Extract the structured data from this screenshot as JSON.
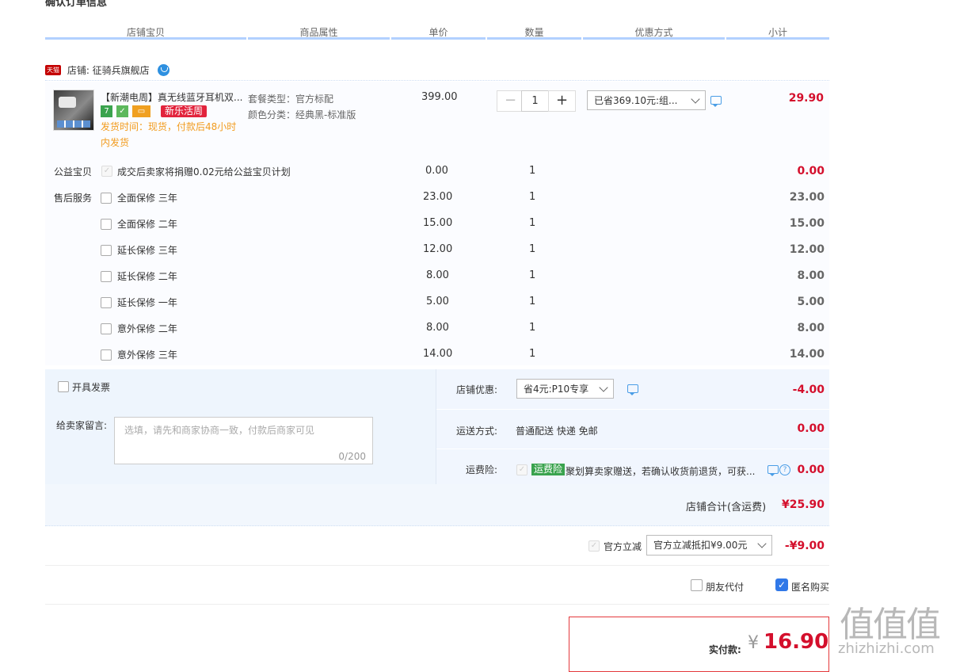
{
  "page_title": "确认订单信息",
  "columns": [
    "店铺宝贝",
    "商品属性",
    "单价",
    "数量",
    "优惠方式",
    "小计"
  ],
  "shop": {
    "badge": "天猫",
    "label": "店铺: 征骑兵旗舰店"
  },
  "item": {
    "title": "【新潮电周】真无线蓝牙耳机双...",
    "icon_7": "7",
    "promo_tag": "新乐活周",
    "delivery": "发货时间：现货，付款后48小时内发货",
    "attr_package": "套餐类型：官方标配",
    "attr_color": "颜色分类：经典黑-标准版",
    "price": "399.00",
    "quantity": "1",
    "minus": "−",
    "plus": "+",
    "discount_select": "已省369.10元:组...",
    "subtotal": "29.90"
  },
  "charity": {
    "label": "公益宝贝",
    "text": "成交后卖家将捐赠0.02元给公益宝贝计划",
    "price": "0.00",
    "qty": "1",
    "subtotal": "0.00"
  },
  "aftersale_label": "售后服务",
  "services": [
    {
      "name": "全面保修 三年",
      "price": "23.00",
      "qty": "1",
      "subtotal": "23.00"
    },
    {
      "name": "全面保修 二年",
      "price": "15.00",
      "qty": "1",
      "subtotal": "15.00"
    },
    {
      "name": "延长保修 三年",
      "price": "12.00",
      "qty": "1",
      "subtotal": "12.00"
    },
    {
      "name": "延长保修 二年",
      "price": "8.00",
      "qty": "1",
      "subtotal": "8.00"
    },
    {
      "name": "延长保修 一年",
      "price": "5.00",
      "qty": "1",
      "subtotal": "5.00"
    },
    {
      "name": "意外保修 二年",
      "price": "8.00",
      "qty": "1",
      "subtotal": "8.00"
    },
    {
      "name": "意外保修 三年",
      "price": "14.00",
      "qty": "1",
      "subtotal": "14.00"
    }
  ],
  "invoice_label": "开具发票",
  "message": {
    "label": "给卖家留言:",
    "placeholder": "选填，请先和商家协商一致，付款后商家可见",
    "counter": "0/200"
  },
  "shop_discount": {
    "label": "店铺优惠:",
    "select": "省4元:P10专享",
    "amount": "-4.00"
  },
  "shipping": {
    "label": "运送方式:",
    "value": "普通配送 快递 免邮",
    "amount": "0.00"
  },
  "insurance": {
    "label": "运费险:",
    "tag": "运费险",
    "text": "聚划算卖家赠送，若确认收货前退货，可获...",
    "amount": "0.00"
  },
  "shop_total": {
    "label": "店铺合计(含运费)",
    "amount": "¥25.90"
  },
  "official_discount": {
    "label": "官方立减",
    "select": "官方立减抵扣¥9.00元",
    "amount": "-¥9.00"
  },
  "friend_pay": "朋友代付",
  "anonymous": "匿名购买",
  "pay": {
    "label": "实付款:",
    "currency": "¥",
    "amount": "16.90"
  },
  "watermark": {
    "logo": "值值值",
    "url": "zhizhizhi.com"
  },
  "colors": {
    "accent_red": "#d40f2c",
    "header_line": "#b2d1ff",
    "panel_bg": "#eef5fd",
    "checkbox_blue": "#3078e8"
  }
}
